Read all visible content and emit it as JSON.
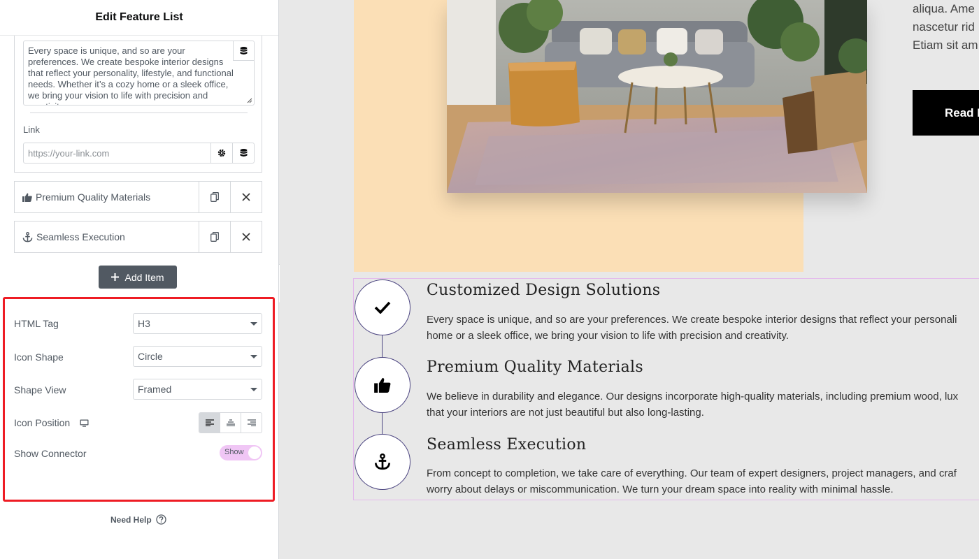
{
  "panel": {
    "title": "Edit Feature List",
    "open_item": {
      "description": "Every space is unique, and so are your preferences. We create bespoke interior designs that reflect your personality, lifestyle, and functional needs. Whether it’s a cozy home or a sleek office, we bring your vision to life with precision and creativity.",
      "link_label": "Link",
      "link_placeholder": "https://your-link.com"
    },
    "items": [
      {
        "label": "Premium Quality Materials",
        "icon": "thumbs-up-icon"
      },
      {
        "label": "Seamless Execution",
        "icon": "anchor-icon"
      }
    ],
    "add_item_label": "Add Item",
    "controls": {
      "html_tag": {
        "label": "HTML Tag",
        "value": "H3"
      },
      "icon_shape": {
        "label": "Icon Shape",
        "value": "Circle"
      },
      "shape_view": {
        "label": "Shape View",
        "value": "Framed"
      },
      "icon_position": {
        "label": "Icon Position",
        "selected": "left"
      },
      "show_connector": {
        "label": "Show Connector",
        "value": "Show"
      }
    },
    "need_help": "Need Help",
    "colors": {
      "highlight": "#ee1c24",
      "toggle": "#f0c6f5",
      "button": "#515962"
    }
  },
  "preview": {
    "right_text": [
      "aliqua. Ame",
      "nascetur rid",
      "Etiam sit am"
    ],
    "read_more_label": "Read I",
    "features": [
      {
        "icon": "check-icon",
        "title": "Customized Design Solutions",
        "desc": [
          "Every space is unique, and so are your preferences. We create bespoke interior designs that reflect your personali",
          "home or a sleek office, we bring your vision to life with precision and creativity."
        ]
      },
      {
        "icon": "thumbs-up-icon",
        "title": "Premium Quality Materials",
        "desc": [
          "We believe in durability and elegance. Our designs incorporate high-quality materials, including premium wood, lux",
          "that your interiors are not just beautiful but also long-lasting."
        ]
      },
      {
        "icon": "anchor-icon",
        "title": "Seamless Execution",
        "desc": [
          "From concept to completion, we take care of everything. Our team of expert designers, project managers, and craf",
          "worry about delays or miscommunication. We turn your dream space into reality with minimal hassle."
        ]
      }
    ],
    "colors": {
      "peach": "#fbdfb6",
      "icon_border": "#4b4480",
      "box_border": "#e4b9ec"
    }
  }
}
